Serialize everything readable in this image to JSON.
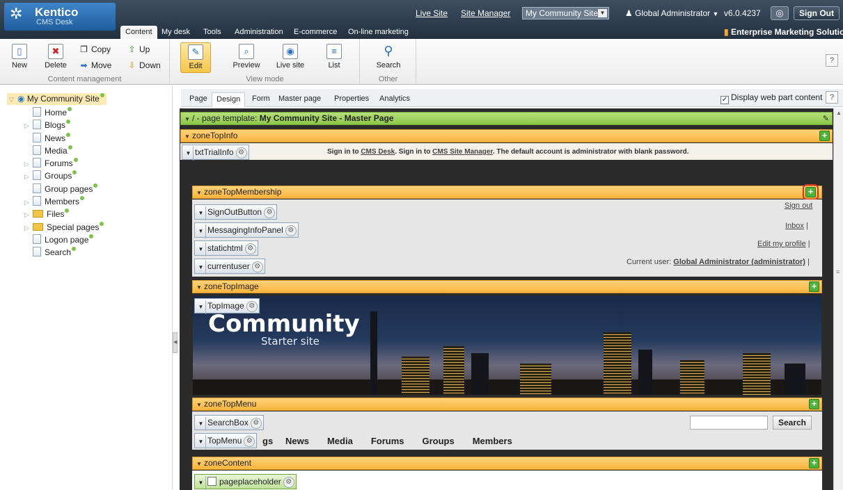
{
  "header": {
    "logo_title": "Kentico",
    "logo_subtitle": "CMS Desk",
    "menu": [
      "Content",
      "My desk",
      "Tools",
      "Administration",
      "E-commerce",
      "On-line marketing"
    ],
    "live_site": "Live Site",
    "site_manager": "Site Manager",
    "site_select": "My Community Site",
    "user": "Global Administrator",
    "version": "v6.0.4237",
    "sign_out": "Sign Out",
    "ems": "Enterprise Marketing Solution"
  },
  "ribbon": {
    "new": "New",
    "delete": "Delete",
    "copy": "Copy",
    "move": "Move",
    "up": "Up",
    "down": "Down",
    "content_management": "Content management",
    "edit": "Edit",
    "preview": "Preview",
    "live_site": "Live site",
    "list": "List",
    "view_mode": "View mode",
    "search": "Search",
    "other": "Other",
    "help": "?"
  },
  "tree": {
    "root": "My Community Site",
    "items": [
      "Home",
      "Blogs",
      "News",
      "Media",
      "Forums",
      "Groups",
      "Group pages",
      "Members",
      "Files",
      "Special pages",
      "Logon page",
      "Search"
    ]
  },
  "tabs": [
    "Page",
    "Design",
    "Form",
    "Master page",
    "Properties",
    "Analytics"
  ],
  "display_webpart": "Display web part content",
  "design": {
    "template_bar": "/ - page template: ",
    "template_name": "My Community Site - Master Page",
    "zone_top_info": "zoneTopInfo",
    "wp_trial": "txtTrialInfo",
    "trial_text_1": "Sign in to ",
    "trial_link_1": "CMS Desk",
    "trial_text_2": ". Sign in to ",
    "trial_link_2": "CMS Site Manager",
    "trial_text_3": ". The default account is administrator with blank password.",
    "zone_membership": "zoneTopMembership",
    "wp_signout": "SignOutButton",
    "wp_messaging": "MessagingInfoPanel",
    "wp_statichtml": "statichtml",
    "wp_currentuser": "currentuser",
    "signout_link": "Sign out",
    "inbox_link": "Inbox",
    "edit_profile_link": "Edit my profile",
    "current_user_label": "Current user:",
    "current_user_value": "Global Administrator (administrator)",
    "zone_top_image": "zoneTopImage",
    "wp_topimage": "TopImage",
    "banner_title": "Community",
    "banner_subtitle": "Starter site",
    "zone_top_menu": "zoneTopMenu",
    "wp_searchbox": "SearchBox",
    "search_button": "Search",
    "wp_topmenu": "TopMenu",
    "menu_items": [
      "gs",
      "News",
      "Media",
      "Forums",
      "Groups",
      "Members"
    ],
    "zone_content": "zoneContent",
    "wp_placeholder": "pageplaceholder"
  },
  "colors": {
    "zone": "#f9b43c",
    "template_bar": "#8cc747",
    "header": "#2d3b4c",
    "accent_add": "#4fb33a"
  }
}
